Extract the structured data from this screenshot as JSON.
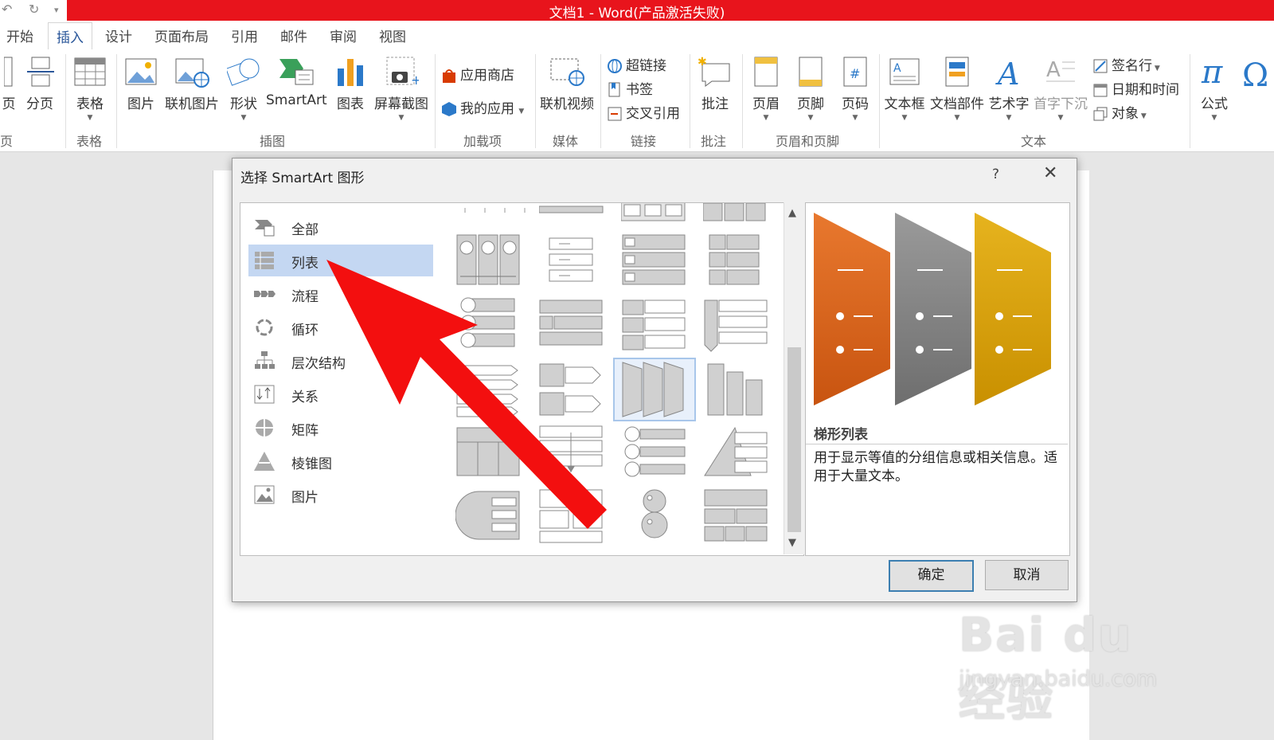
{
  "window": {
    "title": "文档1 -  Word(产品激活失败)"
  },
  "tabs": [
    {
      "label": "开始"
    },
    {
      "label": "插入",
      "active": true
    },
    {
      "label": "设计"
    },
    {
      "label": "页面布局"
    },
    {
      "label": "引用"
    },
    {
      "label": "邮件"
    },
    {
      "label": "审阅"
    },
    {
      "label": "视图"
    }
  ],
  "ribbon": {
    "pages": {
      "page_partial": "页",
      "page_break": "分页",
      "group_partial": "页"
    },
    "table": {
      "table": "表格",
      "group": "表格"
    },
    "illustrations": {
      "picture": "图片",
      "online_picture": "联机图片",
      "shapes": "形状",
      "smartart": "SmartArt",
      "chart": "图表",
      "screenshot": "屏幕截图",
      "group": "插图"
    },
    "addins": {
      "store": "应用商店",
      "my_apps": "我的应用",
      "group": "加载项"
    },
    "media": {
      "online_video": "联机视频",
      "group": "媒体"
    },
    "links": {
      "hyperlink": "超链接",
      "bookmark": "书签",
      "cross_ref": "交叉引用",
      "group": "链接"
    },
    "comments": {
      "comment": "批注",
      "group": "批注"
    },
    "header_footer": {
      "header": "页眉",
      "footer": "页脚",
      "page_number": "页码",
      "group": "页眉和页脚"
    },
    "text": {
      "textbox": "文本框",
      "quick_parts": "文档部件",
      "wordart": "艺术字",
      "dropcap": "首字下沉",
      "signature": "签名行",
      "datetime": "日期和时间",
      "object": "对象",
      "group": "文本"
    },
    "symbols": {
      "equation": "公式"
    }
  },
  "dialog": {
    "title": "选择 SmartArt 图形",
    "help": "?",
    "close": "✕",
    "categories": [
      {
        "label": "全部",
        "icon": "all-icon"
      },
      {
        "label": "列表",
        "icon": "list-icon",
        "selected": true
      },
      {
        "label": "流程",
        "icon": "process-icon"
      },
      {
        "label": "循环",
        "icon": "cycle-icon"
      },
      {
        "label": "层次结构",
        "icon": "hierarchy-icon"
      },
      {
        "label": "关系",
        "icon": "relationship-icon"
      },
      {
        "label": "矩阵",
        "icon": "matrix-icon"
      },
      {
        "label": "棱锥图",
        "icon": "pyramid-icon"
      },
      {
        "label": "图片",
        "icon": "picture-icon"
      }
    ],
    "preview": {
      "name": "梯形列表",
      "description": "用于显示等值的分组信息或相关信息。适用于大量文本。",
      "colors": [
        "#e8782e",
        "#9a9a9a",
        "#e6b31e"
      ]
    },
    "ok": "确定",
    "cancel": "取消"
  },
  "watermark": {
    "brand": "Bai du 经验",
    "url": "jingyan.baidu.com"
  },
  "colors": {
    "title_bar": "#e8141c",
    "selection": "#c4d7f2",
    "arrow": "#f30f0f",
    "accent": "#2b579a"
  }
}
